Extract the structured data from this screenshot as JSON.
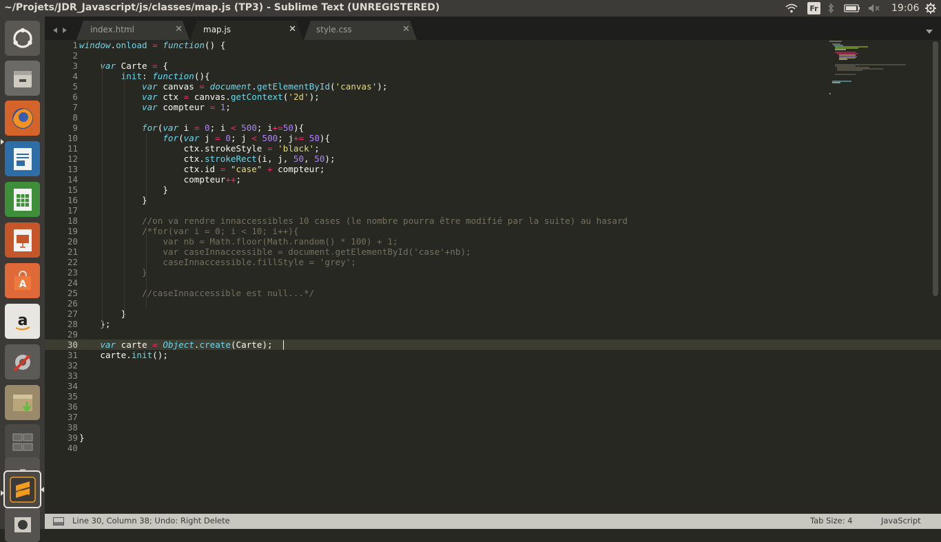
{
  "window": {
    "title": "~/Projets/JDR_Javascript/js/classes/map.js (TP3) - Sublime Text (UNREGISTERED)"
  },
  "topbar": {
    "keyboard_layout": "Fr",
    "clock": "19:06"
  },
  "tabs": [
    {
      "label": "index.html",
      "active": false
    },
    {
      "label": "map.js",
      "active": true
    },
    {
      "label": "style.css",
      "active": false
    }
  ],
  "status": {
    "position": "Line 30, Column 38; Undo: Right Delete",
    "tab_size": "Tab Size: 4",
    "syntax": "JavaScript"
  },
  "editor": {
    "current_line": 30,
    "line_numbers": [
      "1",
      "2",
      "3",
      "4",
      "5",
      "6",
      "7",
      "8",
      "9",
      "10",
      "11",
      "12",
      "13",
      "14",
      "15",
      "16",
      "17",
      "18",
      "19",
      "20",
      "21",
      "22",
      "23",
      "24",
      "25",
      "26",
      "27",
      "28",
      "29",
      "30",
      "31",
      "32",
      "33",
      "34",
      "35",
      "36",
      "37",
      "38",
      "39",
      "40"
    ],
    "lines": [
      "window.onload = function() {",
      "",
      "    var Carte = {",
      "        init: function(){",
      "            var canvas = document.getElementById('canvas');",
      "            var ctx = canvas.getContext('2d');",
      "            var compteur = 1;",
      "",
      "            for(var i = 0; i < 500; i+=50){",
      "                for(var j = 0; j < 500; j+= 50){",
      "                    ctx.strokeStyle = 'black';",
      "                    ctx.strokeRect(i, j, 50, 50);",
      "                    ctx.id = \"case\" + compteur;",
      "                    compteur++;",
      "                }",
      "            }",
      "",
      "            //on va rendre innaccessibles 10 cases (le nombre pourra être modifié par la suite) au hasard",
      "            /*for(var i = 0; i < 10; i++){",
      "                var nb = Math.floor(Math.random() * 100) + 1;",
      "                var caseInnaccessible = document.getElementById('case'+nb);",
      "                caseInnaccessible.fillStyle = 'grey';",
      "            }",
      "",
      "            //caseInnaccessible est null...*/",
      "",
      "        }",
      "    };",
      "",
      "    var carte = Object.create(Carte);",
      "    carte.init();",
      "",
      "",
      "",
      "",
      "",
      "",
      "",
      "}",
      ""
    ]
  },
  "launcher": [
    {
      "name": "ubuntu-dash-icon",
      "bg": "#5a5853"
    },
    {
      "name": "files-icon",
      "bg": "#6b6a66"
    },
    {
      "name": "firefox-icon",
      "bg": "#d4642a"
    },
    {
      "name": "writer-icon",
      "bg": "#2e6ea8"
    },
    {
      "name": "calc-icon",
      "bg": "#3f8f3a"
    },
    {
      "name": "impress-icon",
      "bg": "#c4562a"
    },
    {
      "name": "software-center-icon",
      "bg": "#e0693a"
    },
    {
      "name": "amazon-icon",
      "bg": "#e8e6e0"
    },
    {
      "name": "system-settings-icon",
      "bg": "#5b5a56"
    },
    {
      "name": "archive-manager-icon",
      "bg": "#9a8a6a"
    },
    {
      "name": "workspace-switcher-icon",
      "bg": "#4a4945"
    },
    {
      "name": "usb-drive-icon",
      "bg": "#55534f"
    },
    {
      "name": "sublime-text-icon",
      "bg": "#4a4945"
    },
    {
      "name": "trash-icon",
      "bg": "#55534f"
    }
  ]
}
